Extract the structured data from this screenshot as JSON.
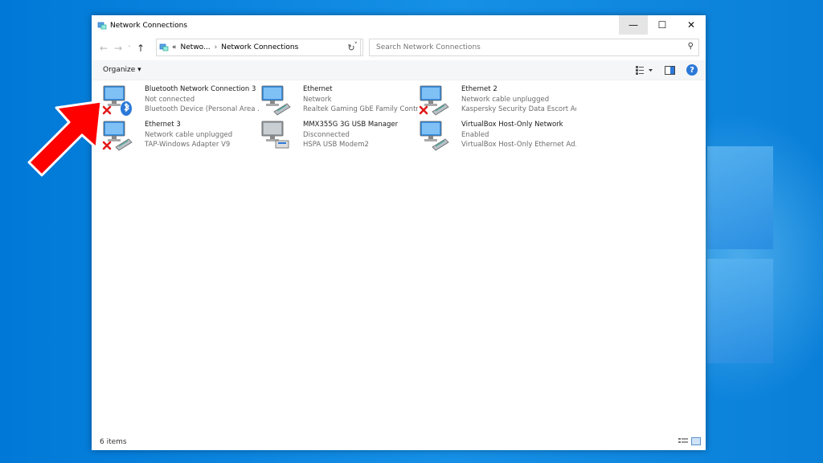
{
  "window": {
    "title": "Network Connections",
    "controls": {
      "minimize": "—",
      "maximize": "☐",
      "close": "✕"
    }
  },
  "address": {
    "crumbs": [
      "Netwo...",
      "Network Connections"
    ],
    "prefix": "«",
    "search_placeholder": "Search Network Connections"
  },
  "toolbar": {
    "organize_label": "Organize ▾"
  },
  "connections": [
    {
      "name": "Bluetooth Network Connection 3",
      "status": "Not connected",
      "adapter": "Bluetooth Device (Personal Area ...",
      "icon": "bluetooth-network-icon",
      "disconnected": true
    },
    {
      "name": "Ethernet",
      "status": "Network",
      "adapter": "Realtek Gaming GbE Family Contr...",
      "icon": "ethernet-network-icon",
      "disconnected": false
    },
    {
      "name": "Ethernet 2",
      "status": "Network cable unplugged",
      "adapter": "Kaspersky Security Data Escort Ad...",
      "icon": "ethernet-network-icon",
      "disconnected": true
    },
    {
      "name": "Ethernet 3",
      "status": "Network cable unplugged",
      "adapter": "TAP-Windows Adapter V9",
      "icon": "ethernet-network-icon",
      "disconnected": true
    },
    {
      "name": "MMX355G 3G USB Manager",
      "status": "Disconnected",
      "adapter": "HSPA USB Modem2",
      "icon": "modem-network-icon",
      "disconnected": false
    },
    {
      "name": "VirtualBox Host-Only Network",
      "status": "Enabled",
      "adapter": "VirtualBox Host-Only Ethernet Ad...",
      "icon": "ethernet-network-icon",
      "disconnected": false
    }
  ],
  "status": {
    "count": "6 items"
  },
  "colors": {
    "desktop": "#0078d7",
    "accent": "#2b78d8",
    "arrow": "#ff0000"
  }
}
